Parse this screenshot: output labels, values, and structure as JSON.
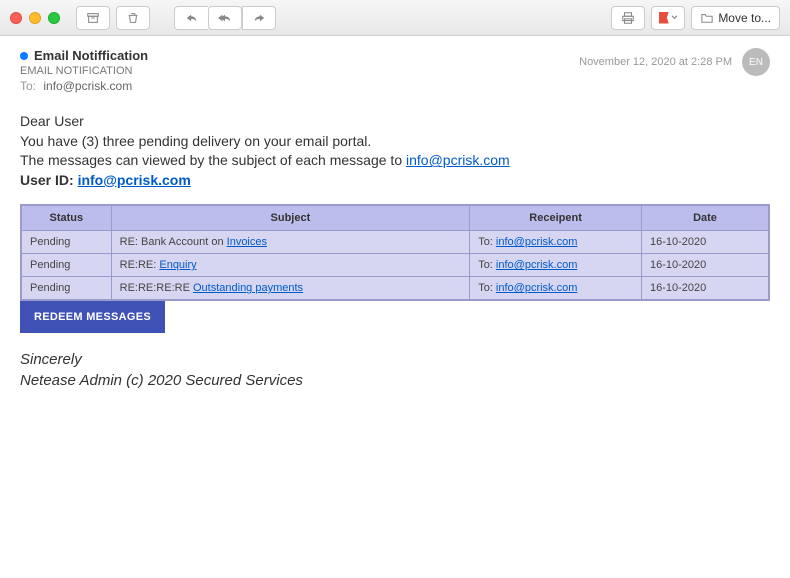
{
  "toolbar": {
    "move_label": "Move to..."
  },
  "header": {
    "subject": "Email Notiffication",
    "sender": "EMAIL NOTIFICATION",
    "to_label": "To:",
    "to_value": "info@pcrisk.com",
    "date": "November 12, 2020 at 2:28 PM",
    "avatar": "EN"
  },
  "body": {
    "greeting": "Dear User",
    "line1": "You have (3) three pending delivery on your email portal.",
    "line2_a": "The messages can viewed by the subject of each message to ",
    "line2_link": "info@pcrisk.com",
    "userid_label": "User ID: ",
    "userid_value": "info@pcrisk.com"
  },
  "table": {
    "headers": {
      "status": "Status",
      "subject": "Subject",
      "recipient": "Receipent",
      "date": "Date"
    },
    "rows": [
      {
        "status": "Pending",
        "subject_prefix": "RE: Bank Account on ",
        "subject_link": "Invoices",
        "to_label": "To: ",
        "to_email": "info@pcrisk.com",
        "date": "16-10-2020"
      },
      {
        "status": "Pending",
        "subject_prefix": "RE:RE: ",
        "subject_link": "Enquiry",
        "to_label": "To: ",
        "to_email": "info@pcrisk.com",
        "date": "16-10-2020"
      },
      {
        "status": "Pending",
        "subject_prefix": "RE:RE:RE:RE ",
        "subject_link": "Outstanding payments",
        "to_label": "To: ",
        "to_email": "info@pcrisk.com",
        "date": "16-10-2020"
      }
    ]
  },
  "button": {
    "redeem": "REDEEM MESSAGES"
  },
  "signature": {
    "line1": "Sincerely",
    "line2": "Netease Admin (c) 2020 Secured Services"
  }
}
